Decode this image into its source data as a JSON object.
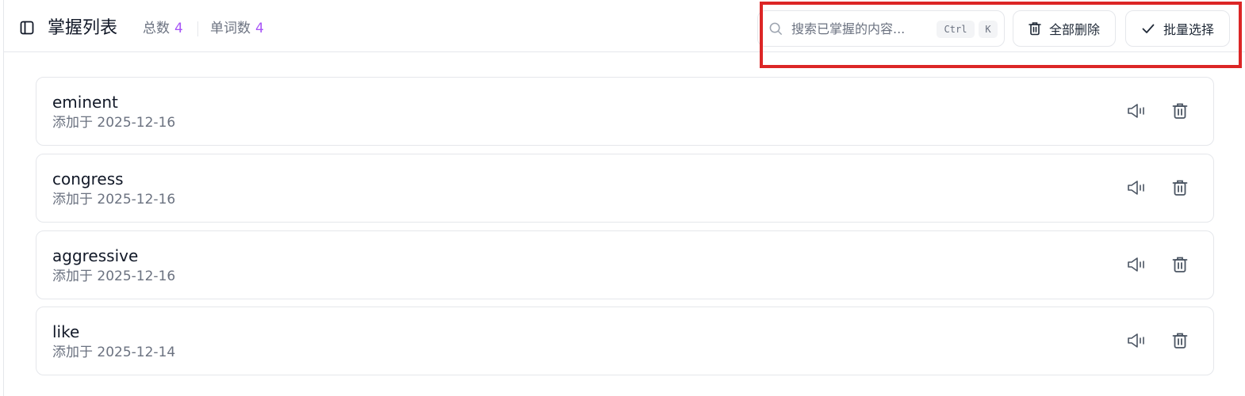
{
  "header": {
    "toggle_icon": "sidebar-toggle-icon",
    "title": "掌握列表",
    "stats": {
      "total_label": "总数",
      "total_value": "4",
      "words_label": "单词数",
      "words_value": "4"
    }
  },
  "search": {
    "placeholder": "搜索已掌握的内容...",
    "icon": "search-icon",
    "shortcut_ctrl": "Ctrl",
    "shortcut_key": "K"
  },
  "toolbar": {
    "delete_all_label": "全部删除",
    "delete_all_icon": "trash-icon",
    "batch_select_label": "批量选择",
    "batch_select_icon": "check-icon"
  },
  "colors": {
    "accent": "#a855f7",
    "highlight": "#dc2626",
    "border": "#e5e7eb",
    "muted": "#6b7280"
  },
  "items": [
    {
      "word": "eminent",
      "date": "添加于 2025-12-16"
    },
    {
      "word": "congress",
      "date": "添加于 2025-12-16"
    },
    {
      "word": "aggressive",
      "date": "添加于 2025-12-16"
    },
    {
      "word": "like",
      "date": "添加于 2025-12-14"
    }
  ]
}
